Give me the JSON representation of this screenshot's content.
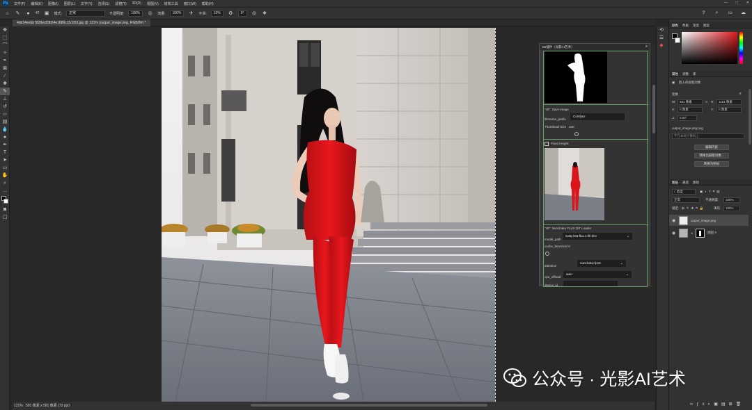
{
  "menubar": {
    "items": [
      "文件(F)",
      "编辑(E)",
      "图像(I)",
      "图层(L)",
      "文字(Y)",
      "选择(S)",
      "滤镜(T)",
      "3D(D)",
      "视图(V)",
      "增效工具",
      "窗口(W)",
      "帮助(H)"
    ],
    "win_controls": [
      "—",
      "□",
      "✕"
    ]
  },
  "options": {
    "brush_size": "47",
    "mode_label": "模式:",
    "mode_value": "正常",
    "opacity_label": "不透明度:",
    "opacity_value": "100%",
    "flow_label": "流量:",
    "flow_value": "100%",
    "smooth_label": "平滑:",
    "smooth_value": "10%",
    "angle_value": "0°"
  },
  "document": {
    "tab_title": "4dd34eebb7828ec83b54e1686c15c053.jpg @ 121% (output_image.png, RGB/8#) *"
  },
  "status": {
    "zoom": "121%",
    "doc_info": "591 像素 x 591 像素 (72 ppi)"
  },
  "sd_panel": {
    "title": "SD插件（光影AI艺术）",
    "save_node": "\"48\": Save Image",
    "filename_prefix_label": "filename_prefix",
    "filename_prefix_value": "ComfyUI",
    "thumbnail_label": "Thumbnail Size",
    "thumbnail_value": "200",
    "fixed_height_label": "Fixed Height:",
    "loader_node": "\"49\": Nunchaku FLUX DiT Loader",
    "model_path_label": "model_path",
    "model_path_value": "svdq-int4-flux.1-fill-dev",
    "cache_threshold_label": "cache_threshold 0",
    "attention_label": "attention",
    "attention_value": "nunchaku-fp16",
    "cpu_offload_label": "cpu_offload",
    "cpu_offload_value": "auto",
    "device_id_label": "device_id"
  },
  "color_panel": {
    "tabs": [
      "颜色",
      "色板",
      "渐变",
      "图案"
    ],
    "accent": "#e0181e"
  },
  "properties_panel": {
    "tabs": [
      "属性",
      "调整",
      "库"
    ],
    "object_type": "嵌入的智能对象",
    "transform_label": "变换",
    "w_label": "W:",
    "w_value": "591 像素",
    "h_label": "H:",
    "h_value": "1161 像素",
    "x_label": "X:",
    "x_value": "0 像素",
    "y_label": "Y:",
    "y_value": "0 像素",
    "angle_value": "0.00°",
    "file_name": "output_image.png.png",
    "file_hint": "不在本地计算机上",
    "btn_edit": "编辑内容",
    "btn_convert_linked": "转换为链接对象...",
    "btn_convert_layers": "转换为图层"
  },
  "layers_panel": {
    "tabs": [
      "图层",
      "通道",
      "路径"
    ],
    "filter_type": "类型",
    "blend_mode": "正常",
    "opacity_label": "不透明度:",
    "opacity_value": "100%",
    "lock_label": "锁定:",
    "fill_label": "填充:",
    "fill_value": "100%",
    "layers": [
      {
        "name": "output_image.png"
      },
      {
        "name": "图层 0"
      }
    ]
  },
  "watermark": {
    "text": "公众号 · 光影AI艺术"
  }
}
